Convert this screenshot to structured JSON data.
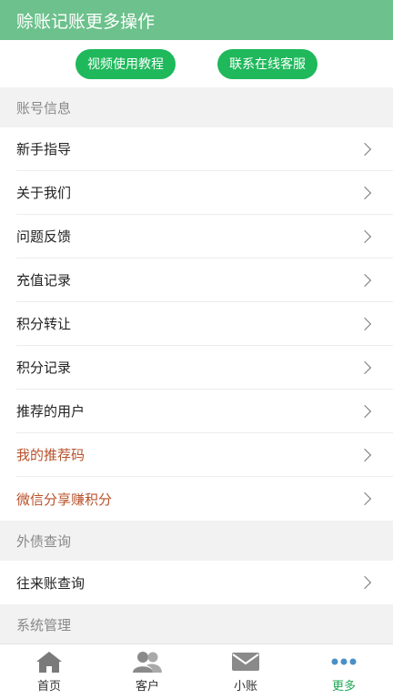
{
  "header": {
    "title": "赊账记账更多操作"
  },
  "actions": {
    "video_label": "视频使用教程",
    "service_label": "联系在线客服"
  },
  "sections": {
    "account": {
      "title": "账号信息",
      "items": [
        "新手指导",
        "关于我们",
        "问题反馈",
        "充值记录",
        "积分转让",
        "积分记录",
        "推荐的用户",
        "我的推荐码",
        "微信分享赚积分"
      ]
    },
    "debt": {
      "title": "外债查询",
      "items": [
        "往来账查询"
      ]
    },
    "system": {
      "title": "系统管理"
    }
  },
  "tabs": [
    {
      "label": "首页",
      "icon": "home-icon"
    },
    {
      "label": "客户",
      "icon": "customers-icon"
    },
    {
      "label": "小账",
      "icon": "mail-icon"
    },
    {
      "label": "更多",
      "icon": "more-icon"
    }
  ],
  "colors": {
    "header": "#6cc18c",
    "pill": "#1fb85b",
    "accent_text": "#b8512a",
    "active_tab": "#1fa854"
  }
}
